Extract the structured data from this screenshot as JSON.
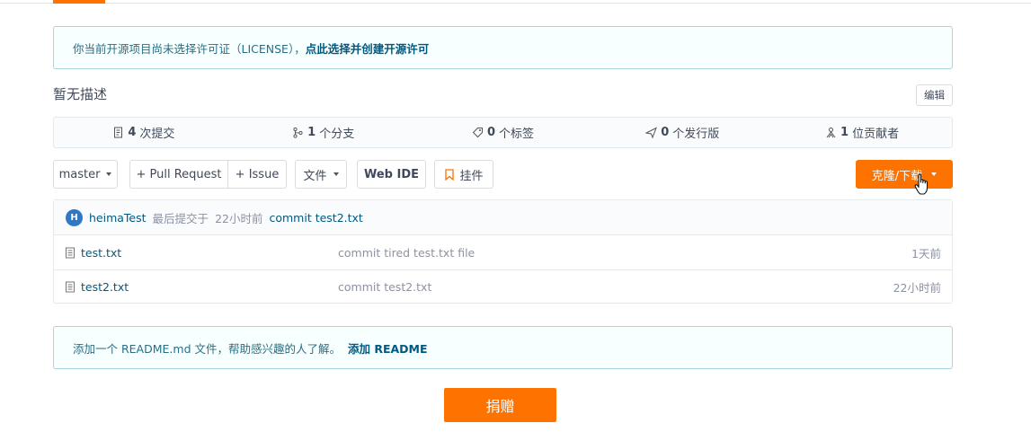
{
  "notice_license": {
    "text": "你当前开源项目尚未选择许可证（LICENSE），",
    "link": "点此选择并创建开源许可"
  },
  "description": "暂无描述",
  "edit_label": "编辑",
  "stats": {
    "commits": {
      "count": "4",
      "label": "次提交",
      "icon": "commit-icon"
    },
    "branches": {
      "count": "1",
      "label": "个分支",
      "icon": "branch-icon"
    },
    "tags": {
      "count": "0",
      "label": "个标签",
      "icon": "tag-icon"
    },
    "releases": {
      "count": "0",
      "label": "个发行版",
      "icon": "release-icon"
    },
    "contributors": {
      "count": "1",
      "label": "位贡献者",
      "icon": "contributors-icon"
    }
  },
  "toolbar": {
    "branch": "master",
    "pull_request": "+ Pull Request",
    "issue": "+ Issue",
    "files": "文件",
    "web_ide": "Web IDE",
    "widget": "挂件",
    "clone": "克隆/下载"
  },
  "last_commit": {
    "avatar_letter": "H",
    "user": "heimaTest",
    "prefix": "最后提交于",
    "time": "22小时前",
    "message": "commit test2.txt"
  },
  "files": [
    {
      "name": "test.txt",
      "commit": "commit tired test.txt file",
      "time": "1天前"
    },
    {
      "name": "test2.txt",
      "commit": "commit test2.txt",
      "time": "22小时前"
    }
  ],
  "notice_readme": {
    "text": "添加一个 README.md 文件，帮助感兴趣的人了解。",
    "link": "添加 README"
  },
  "donate": "捐赠",
  "colors": {
    "accent": "#fe7300",
    "link": "#005980",
    "notice_border": "#a9d5de"
  }
}
